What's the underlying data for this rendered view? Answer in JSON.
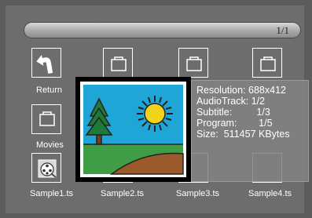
{
  "page_bar": {
    "page_indicator": "1/1"
  },
  "items": [
    {
      "label": "Return",
      "icon": "return-arrow-icon"
    },
    {
      "label": "Movies",
      "icon": "folder-icon"
    },
    {
      "label": "Sample1.ts",
      "icon": "film-reel-icon"
    },
    {
      "label": "Sample2.ts",
      "icon": "folder-icon"
    },
    {
      "label": "Sample3.ts",
      "icon": "folder-icon"
    },
    {
      "label": "Sample4.ts",
      "icon": "folder-icon"
    }
  ],
  "preview": {
    "icon": "landscape-thumbnail-icon"
  },
  "info": {
    "resolution": "Resolution: 688x412",
    "audio_track": "AudioTrack:  1/2",
    "subtitle": "Subtitle:         1/3",
    "program": "Program:        1/5",
    "size": "Size:  511457 KBytes"
  },
  "colors": {
    "background": "#6d6d6d",
    "preview_sky": "#1fa6d6",
    "preview_sun": "#f2d21a",
    "preview_grass": "#3f9e45",
    "preview_ground": "#9a5a2c",
    "preview_tree": "#1f7a3a"
  }
}
